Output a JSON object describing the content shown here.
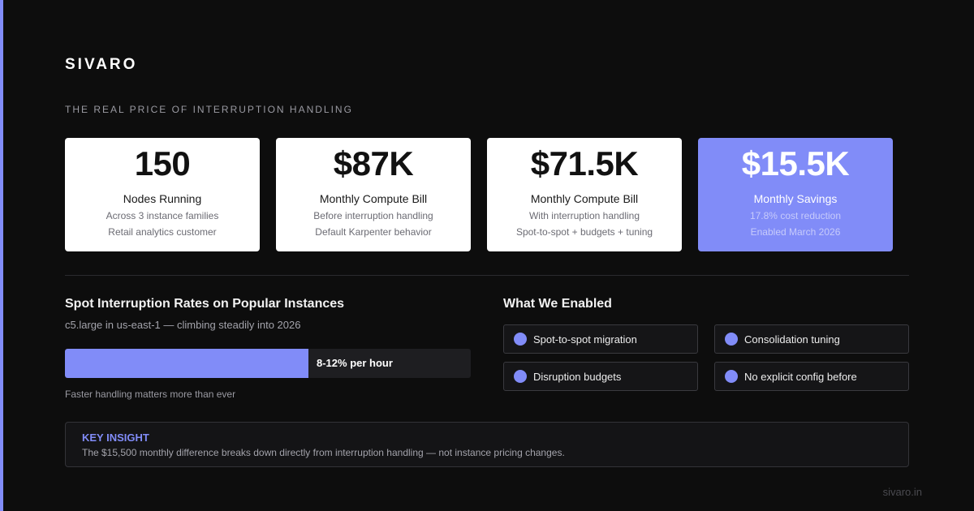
{
  "brand": "SIVARO",
  "eyebrow": "THE REAL PRICE OF INTERRUPTION HANDLING",
  "colors": {
    "accent": "#818cf8",
    "background": "#0d0d0d",
    "card": "#ffffff"
  },
  "cards": [
    {
      "value": "150",
      "label": "Nodes Running",
      "sub1": "Across 3 instance families",
      "sub2": "Retail analytics customer"
    },
    {
      "value": "$87K",
      "label": "Monthly Compute Bill",
      "sub1": "Before interruption handling",
      "sub2": "Default Karpenter behavior"
    },
    {
      "value": "$71.5K",
      "label": "Monthly Compute Bill",
      "sub1": "With interruption handling",
      "sub2": "Spot-to-spot + budgets + tuning"
    },
    {
      "value": "$15.5K",
      "label": "Monthly Savings",
      "sub1": "17.8% cost reduction",
      "sub2": "Enabled March 2026"
    }
  ],
  "interruption": {
    "title": "Spot Interruption Rates on Popular Instances",
    "subtitle": "c5.large in us-east-1 — climbing steadily into 2026",
    "bar_label": "8-12% per hour",
    "bar_fill_fraction": 0.6,
    "note": "Faster handling matters more than ever"
  },
  "enabled": {
    "title": "What We Enabled",
    "items": [
      {
        "label": "Spot-to-spot migration"
      },
      {
        "label": "Consolidation tuning"
      },
      {
        "label": "Disruption budgets"
      },
      {
        "label": "No explicit config before"
      }
    ]
  },
  "insight": {
    "title": "KEY INSIGHT",
    "text": "The $15,500 monthly difference breaks down directly from interruption handling — not instance pricing changes."
  },
  "footer": "sivaro.in"
}
